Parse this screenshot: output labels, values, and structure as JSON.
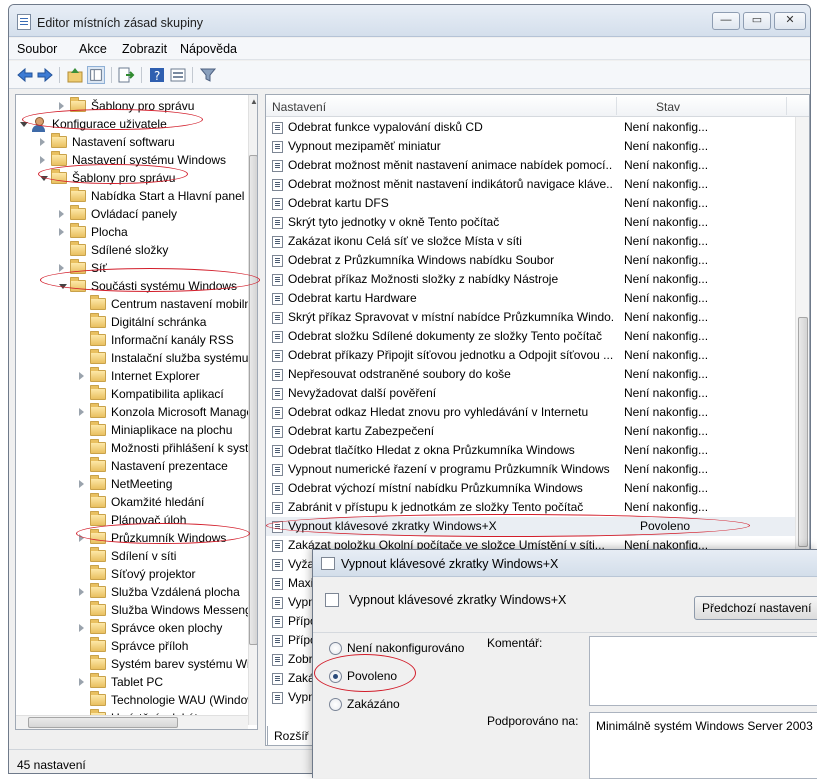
{
  "window": {
    "title": "Editor místních zásad skupiny"
  },
  "menu": [
    "Soubor",
    "Akce",
    "Zobrazit",
    "Nápověda"
  ],
  "tree": [
    {
      "label": "Šablony pro správu",
      "level": 2,
      "expander": "closed",
      "icon": "folder"
    },
    {
      "label": "Konfigurace uživatele",
      "level": 0,
      "expander": "open",
      "icon": "user",
      "highlighted": true
    },
    {
      "label": "Nastavení softwaru",
      "level": 1,
      "expander": "closed",
      "icon": "folder"
    },
    {
      "label": "Nastavení systému Windows",
      "level": 1,
      "expander": "closed",
      "icon": "folder"
    },
    {
      "label": "Šablony pro správu",
      "level": 1,
      "expander": "open",
      "icon": "folder",
      "highlighted": true
    },
    {
      "label": "Nabídka Start a Hlavní panel",
      "level": 2,
      "expander": "none",
      "icon": "folder"
    },
    {
      "label": "Ovládací panely",
      "level": 2,
      "expander": "closed",
      "icon": "folder"
    },
    {
      "label": "Plocha",
      "level": 2,
      "expander": "closed",
      "icon": "folder"
    },
    {
      "label": "Sdílené složky",
      "level": 2,
      "expander": "none",
      "icon": "folder"
    },
    {
      "label": "Síť",
      "level": 2,
      "expander": "closed",
      "icon": "folder"
    },
    {
      "label": "Součásti systému Windows",
      "level": 2,
      "expander": "open",
      "icon": "folder",
      "highlighted": true
    },
    {
      "label": "Centrum nastavení mobilních zařízení",
      "level": 3,
      "expander": "none",
      "icon": "folder"
    },
    {
      "label": "Digitální schránka",
      "level": 3,
      "expander": "none",
      "icon": "folder"
    },
    {
      "label": "Informační kanály RSS",
      "level": 3,
      "expander": "none",
      "icon": "folder"
    },
    {
      "label": "Instalační služba systému Windows",
      "level": 3,
      "expander": "none",
      "icon": "folder"
    },
    {
      "label": "Internet Explorer",
      "level": 3,
      "expander": "closed",
      "icon": "folder"
    },
    {
      "label": "Kompatibilita aplikací",
      "level": 3,
      "expander": "none",
      "icon": "folder"
    },
    {
      "label": "Konzola Microsoft Management Console",
      "level": 3,
      "expander": "closed",
      "icon": "folder"
    },
    {
      "label": "Miniaplikace na plochu",
      "level": 3,
      "expander": "none",
      "icon": "folder"
    },
    {
      "label": "Možnosti přihlášení k systému Windows",
      "level": 3,
      "expander": "none",
      "icon": "folder"
    },
    {
      "label": "Nastavení prezentace",
      "level": 3,
      "expander": "none",
      "icon": "folder"
    },
    {
      "label": "NetMeeting",
      "level": 3,
      "expander": "closed",
      "icon": "folder"
    },
    {
      "label": "Okamžité hledání",
      "level": 3,
      "expander": "none",
      "icon": "folder"
    },
    {
      "label": "Plánovač úloh",
      "level": 3,
      "expander": "none",
      "icon": "folder"
    },
    {
      "label": "Průzkumník Windows",
      "level": 3,
      "expander": "closed",
      "icon": "folder",
      "highlighted": true
    },
    {
      "label": "Sdílení v síti",
      "level": 3,
      "expander": "none",
      "icon": "folder"
    },
    {
      "label": "Síťový projektor",
      "level": 3,
      "expander": "none",
      "icon": "folder"
    },
    {
      "label": "Služba Vzdálená plocha",
      "level": 3,
      "expander": "closed",
      "icon": "folder"
    },
    {
      "label": "Služba Windows Messenger",
      "level": 3,
      "expander": "none",
      "icon": "folder"
    },
    {
      "label": "Správce oken plochy",
      "level": 3,
      "expander": "closed",
      "icon": "folder"
    },
    {
      "label": "Správce příloh",
      "level": 3,
      "expander": "none",
      "icon": "folder"
    },
    {
      "label": "Systém barev systému Windows",
      "level": 3,
      "expander": "none",
      "icon": "folder"
    },
    {
      "label": "Tablet PC",
      "level": 3,
      "expander": "closed",
      "icon": "folder"
    },
    {
      "label": "Technologie WAU (Windows Anytime Upgrade)",
      "level": 3,
      "expander": "none",
      "icon": "folder"
    },
    {
      "label": "Umístění a lokátory",
      "level": 3,
      "expander": "none",
      "icon": "folder"
    }
  ],
  "list": {
    "col_setting": "Nastavení",
    "col_state": "Stav",
    "rows": [
      {
        "name": "Odebrat funkce vypalování disků CD",
        "state": "Není nakonfig..."
      },
      {
        "name": "Vypnout mezipaměť miniatur",
        "state": "Není nakonfig..."
      },
      {
        "name": "Odebrat možnost měnit nastavení animace nabídek pomocí...",
        "state": "Není nakonfig..."
      },
      {
        "name": "Odebrat možnost měnit nastavení indikátorů navigace kláve...",
        "state": "Není nakonfig..."
      },
      {
        "name": "Odebrat kartu DFS",
        "state": "Není nakonfig..."
      },
      {
        "name": "Skrýt tyto jednotky v okně Tento počítač",
        "state": "Není nakonfig..."
      },
      {
        "name": "Zakázat ikonu Celá síť ve složce Místa v síti",
        "state": "Není nakonfig..."
      },
      {
        "name": "Odebrat z Průzkumníka Windows nabídku Soubor",
        "state": "Není nakonfig..."
      },
      {
        "name": "Odebrat příkaz Možnosti složky z nabídky Nástroje",
        "state": "Není nakonfig..."
      },
      {
        "name": "Odebrat kartu Hardware",
        "state": "Není nakonfig..."
      },
      {
        "name": "Skrýt příkaz Spravovat v místní nabídce Průzkumníka Windo...",
        "state": "Není nakonfig..."
      },
      {
        "name": "Odebrat složku Sdílené dokumenty ze složky Tento počítač",
        "state": "Není nakonfig..."
      },
      {
        "name": "Odebrat příkazy Připojit síťovou jednotku a Odpojit síťovou ...",
        "state": "Není nakonfig..."
      },
      {
        "name": "Nepřesouvat odstraněné soubory do koše",
        "state": "Není nakonfig..."
      },
      {
        "name": "Nevyžadovat další pověření",
        "state": "Není nakonfig..."
      },
      {
        "name": "Odebrat odkaz Hledat znovu pro vyhledávání v Internetu",
        "state": "Není nakonfig..."
      },
      {
        "name": "Odebrat kartu Zabezpečení",
        "state": "Není nakonfig..."
      },
      {
        "name": "Odebrat tlačítko Hledat z okna Průzkumníka Windows",
        "state": "Není nakonfig..."
      },
      {
        "name": "Vypnout numerické řazení v programu Průzkumník Windows",
        "state": "Není nakonfig..."
      },
      {
        "name": "Odebrat výchozí místní nabídku Průzkumníka Windows",
        "state": "Není nakonfig..."
      },
      {
        "name": "Zabránit v přístupu k jednotkám ze složky Tento počítač",
        "state": "Není nakonfig..."
      },
      {
        "name": "Vypnout klávesové zkratky Windows+X",
        "state": "Povoleno",
        "highlighted": true
      },
      {
        "name": "Zakázat položku Okolní počítače ve složce Umístění v síti...",
        "state": "Není nakonfig..."
      },
      {
        "name": "Vyža",
        "state": ""
      },
      {
        "name": "Maxi",
        "state": ""
      },
      {
        "name": "Vypn",
        "state": ""
      },
      {
        "name": "Přípo",
        "state": ""
      },
      {
        "name": "Přípo",
        "state": ""
      },
      {
        "name": "Zobr",
        "state": ""
      },
      {
        "name": "Zaká",
        "state": ""
      },
      {
        "name": "Vypn",
        "state": ""
      }
    ],
    "tab_extended": "Rozšíř"
  },
  "dialog": {
    "title": "Vypnout klávesové zkratky Windows+X",
    "heading": "Vypnout klávesové zkratky Windows+X",
    "prev_button": "Předchozí nastavení",
    "options": [
      {
        "label": "Není nakonfigurováno",
        "selected": false
      },
      {
        "label": "Povoleno",
        "selected": true
      },
      {
        "label": "Zakázáno",
        "selected": false
      }
    ],
    "comment_label": "Komentář:",
    "supported_label": "Podporováno na:",
    "supported_value": "Minimálně systém Windows Server 2003"
  },
  "status": "45 nastavení",
  "highlight_color": "#d21d2a"
}
